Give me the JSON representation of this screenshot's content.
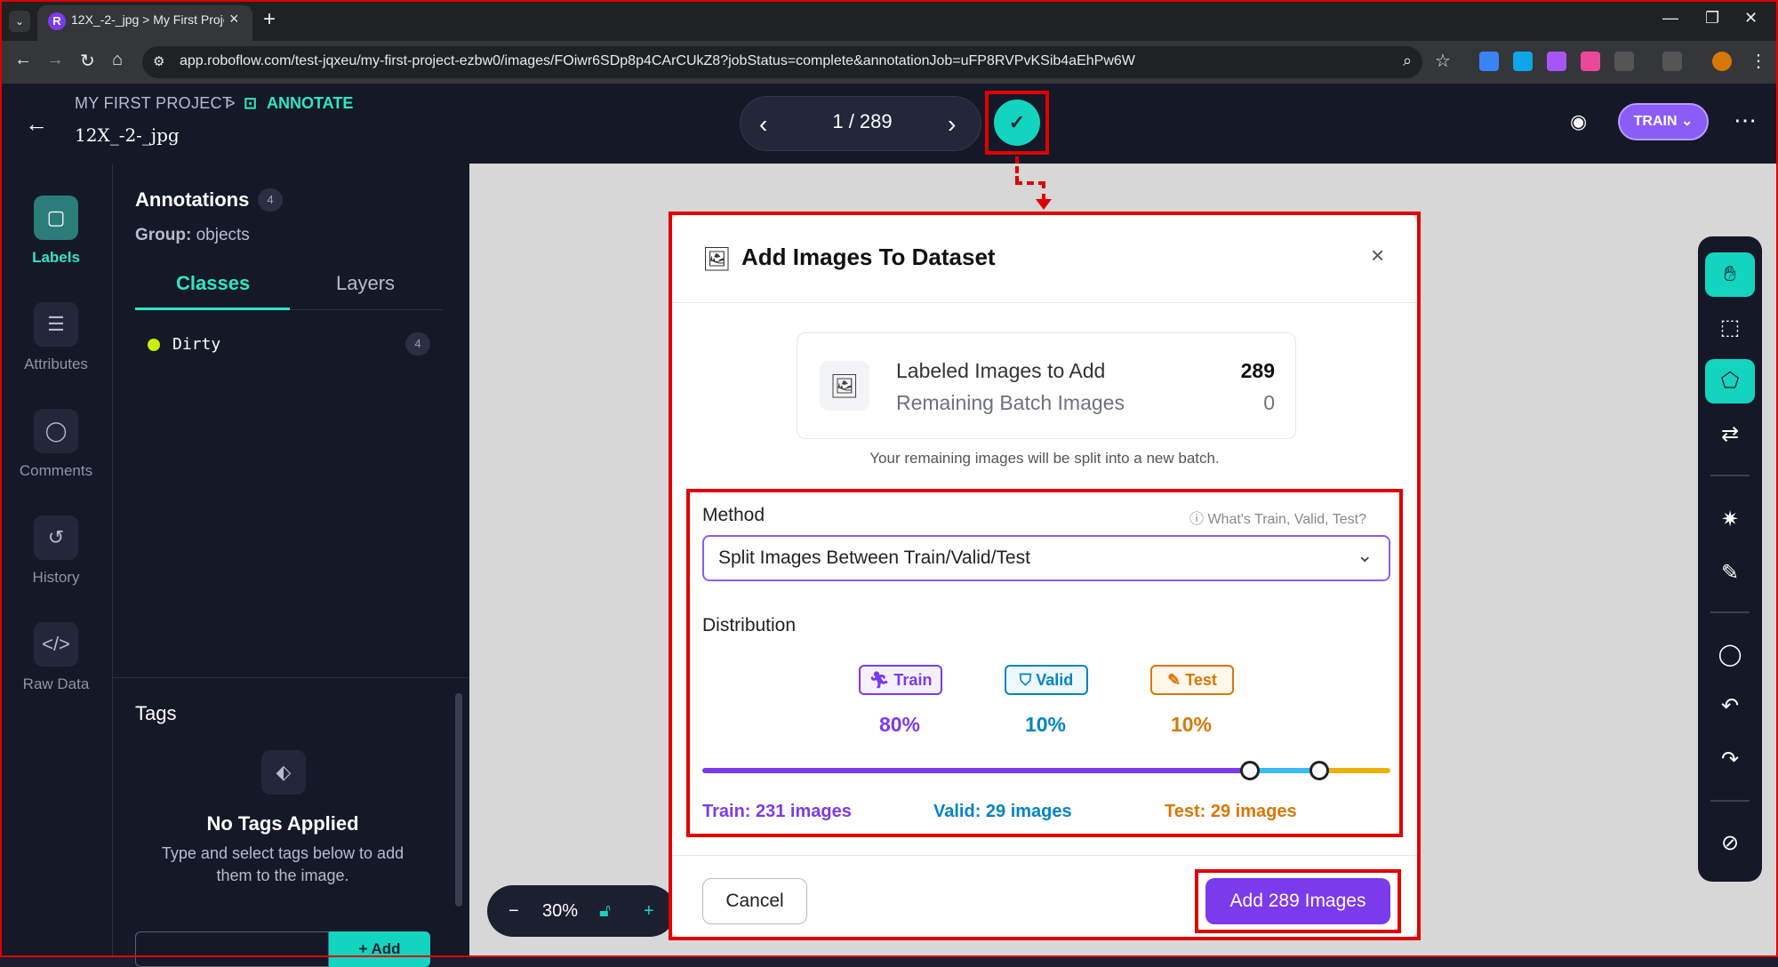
{
  "browser": {
    "tab_title": "12X_-2-_jpg > My First Proje",
    "tab_close": "×",
    "new_tab": "+",
    "url": "app.roboflow.com/test-jqxeu/my-first-project-ezbw0/images/FOiwr6SDp8p4CArCUkZ8?jobStatus=complete&annotationJob=uFP8RVPvKSib4aEhPw6W"
  },
  "header": {
    "breadcrumb_project": "MY FIRST PROJECT",
    "breadcrumb_sep": ">",
    "breadcrumb_mode": "ANNOTATE",
    "filename": "12X_-2-_jpg",
    "pager": "1 / 289",
    "train_label": "TRAIN"
  },
  "rail": {
    "items": [
      {
        "label": "Labels"
      },
      {
        "label": "Attributes"
      },
      {
        "label": "Comments"
      },
      {
        "label": "History"
      },
      {
        "label": "Raw Data"
      }
    ]
  },
  "panel": {
    "title": "Annotations",
    "count": "4",
    "group_label": "Group:",
    "group_value": "objects",
    "tab_classes": "Classes",
    "tab_layers": "Layers",
    "classes": [
      {
        "name": "Dirty",
        "count": "4",
        "color": "#c8f000"
      }
    ],
    "tags_title": "Tags",
    "no_tags": "No Tags Applied",
    "no_tags_sub": "Type and select tags below to add them to the image.",
    "add_label": "+ Add"
  },
  "zoom": {
    "level": "30%",
    "minus": "−",
    "plus": "+"
  },
  "modal": {
    "title": "Add Images To Dataset",
    "close": "×",
    "labeled_label": "Labeled Images to Add",
    "labeled_value": "289",
    "remaining_label": "Remaining Batch Images",
    "remaining_value": "0",
    "note": "Your remaining images will be split into a new batch.",
    "method_label": "Method",
    "whats_link": "What's Train, Valid, Test?",
    "method_value": "Split Images Between Train/Valid/Test",
    "distribution_label": "Distribution",
    "train_chip": "Train",
    "valid_chip": "Valid",
    "test_chip": "Test",
    "train_pct": "80%",
    "valid_pct": "10%",
    "test_pct": "10%",
    "train_count": "Train: 231 images",
    "valid_count": "Valid: 29 images",
    "test_count": "Test: 29 images",
    "cancel": "Cancel",
    "add_button": "Add 289 Images"
  },
  "colors": {
    "accent_teal": "#13d4bf",
    "train": "#7c3aed",
    "valid": "#0284c7",
    "test": "#d97706",
    "highlight": "#e00000"
  }
}
